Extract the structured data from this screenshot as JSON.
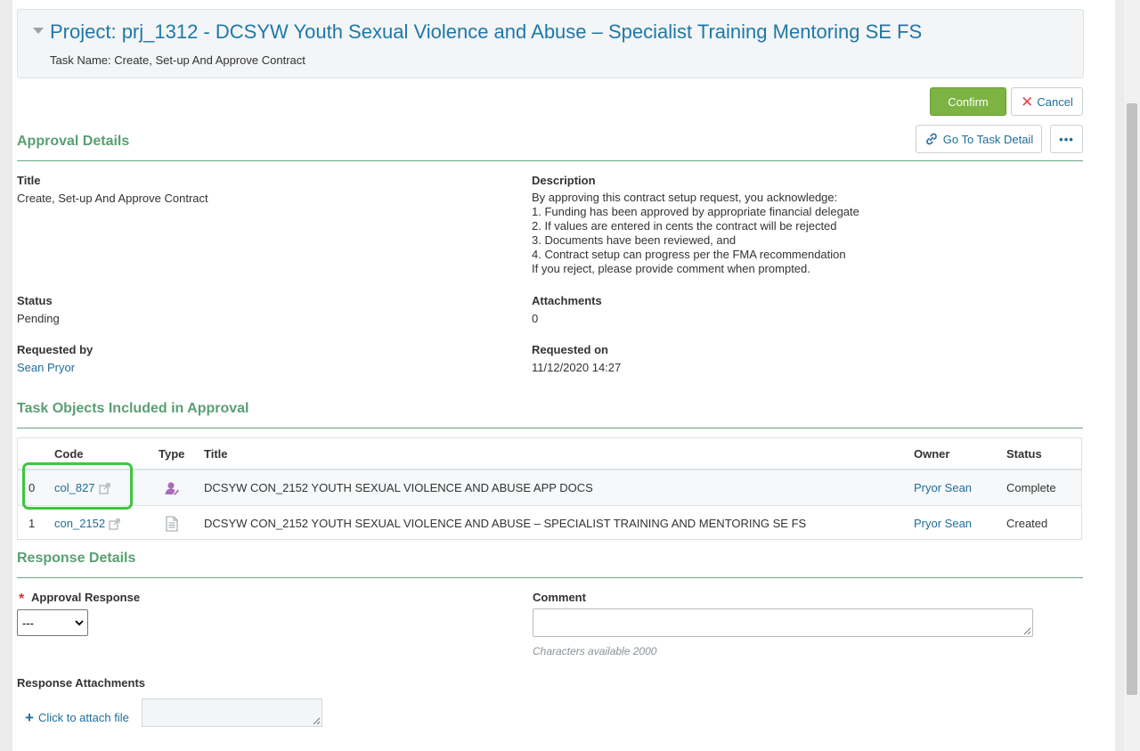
{
  "header": {
    "project_title": "Project: prj_1312 - DCSYW Youth Sexual Violence and Abuse – Specialist Training Mentoring SE FS",
    "task_name": "Task Name: Create, Set-up And Approve Contract"
  },
  "actions": {
    "confirm_label": "Confirm",
    "cancel_label": "Cancel",
    "goto_task_label": "Go To Task Detail",
    "more_label": "•••"
  },
  "approval_details": {
    "section_title": "Approval Details",
    "title_label": "Title",
    "title_value": "Create, Set-up And Approve Contract",
    "description_label": "Description",
    "description_lines": [
      "By approving this contract setup request, you acknowledge:",
      "1. Funding has been approved by appropriate financial delegate",
      "2. If values are entered in cents the contract will be rejected",
      "3. Documents have been reviewed, and",
      "4. Contract setup can progress per the FMA recommendation",
      "If you reject, please provide comment when prompted."
    ],
    "status_label": "Status",
    "status_value": "Pending",
    "attachments_label": "Attachments",
    "attachments_value": "0",
    "requested_by_label": "Requested by",
    "requested_by_value": "Sean Pryor",
    "requested_on_label": "Requested on",
    "requested_on_value": "11/12/2020 14:27"
  },
  "task_objects": {
    "section_title": "Task Objects Included in Approval",
    "columns": {
      "code": "Code",
      "type": "Type",
      "title": "Title",
      "owner": "Owner",
      "status": "Status"
    },
    "rows": [
      {
        "index": "0",
        "code": "col_827",
        "type_icon": "user-collaborator-icon",
        "title": "DCSYW CON_2152 YOUTH SEXUAL VIOLENCE AND ABUSE APP DOCS",
        "owner": "Pryor Sean",
        "status": "Complete"
      },
      {
        "index": "1",
        "code": "con_2152",
        "type_icon": "document-icon",
        "title": "DCSYW CON_2152 YOUTH SEXUAL VIOLENCE AND ABUSE – SPECIALIST TRAINING AND MENTORING SE FS",
        "owner": "Pryor Sean",
        "status": "Created"
      }
    ]
  },
  "response_details": {
    "section_title": "Response Details",
    "approval_response_label": "Approval Response",
    "approval_response_value": "---",
    "required_marker": "*",
    "comment_label": "Comment",
    "comment_value": "",
    "characters_available": "Characters available 2000",
    "response_attachments_label": "Response Attachments",
    "attach_link_label": "Click to attach file"
  },
  "colors": {
    "accent_blue": "#1f78a8",
    "section_green": "#5a9f73",
    "confirm_green": "#7cb342",
    "cancel_red": "#e0474c",
    "highlight_green": "#3fc63f"
  }
}
